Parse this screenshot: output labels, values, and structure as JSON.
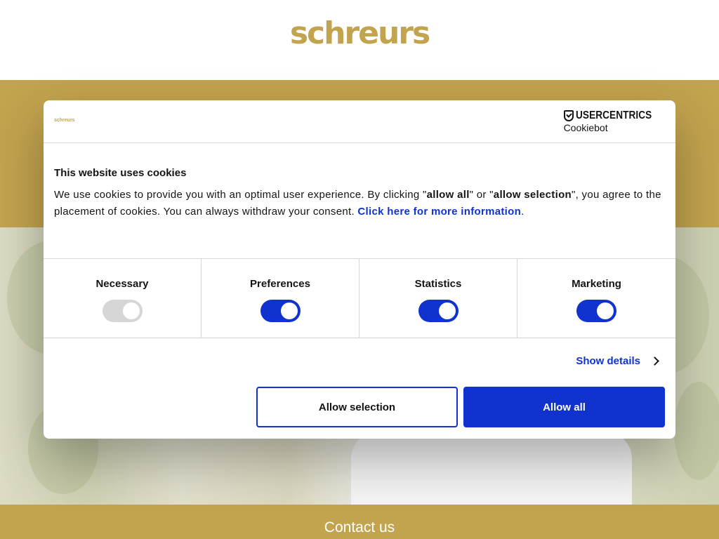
{
  "site": {
    "logo": "schreurs",
    "footer_title": "Contact us"
  },
  "dialog": {
    "mini_logo": "schreurs",
    "brand_name": "USERCENTRICS",
    "brand_sub": "Cookiebot",
    "title": "This website uses cookies",
    "text_1": "We use cookies to provide you with an optimal user experience. By clicking \"",
    "text_bold_1": "allow all",
    "text_2": "\" or \"",
    "text_bold_2": "allow selection",
    "text_3": "\", you agree to the placement of cookies. You can always withdraw your consent. ",
    "link": "Click here for more information",
    "text_4": ".",
    "categories": [
      {
        "label": "Necessary",
        "enabled": true,
        "locked": true
      },
      {
        "label": "Preferences",
        "enabled": true,
        "locked": false
      },
      {
        "label": "Statistics",
        "enabled": true,
        "locked": false
      },
      {
        "label": "Marketing",
        "enabled": true,
        "locked": false
      }
    ],
    "show_details": "Show details",
    "allow_selection": "Allow selection",
    "allow_all": "Allow all"
  },
  "colors": {
    "gold": "#c2a34e",
    "accent_blue": "#1032cf"
  }
}
